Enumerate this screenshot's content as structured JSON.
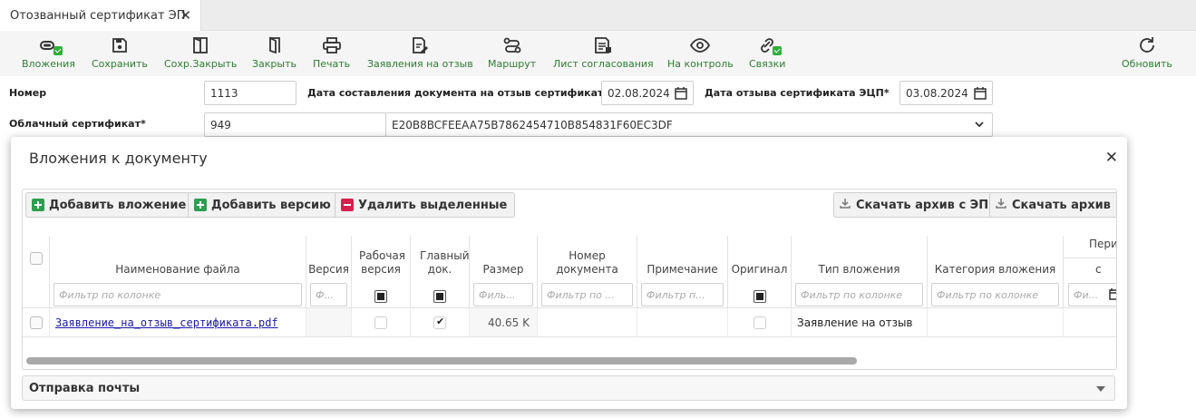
{
  "tab": {
    "title": "Отозванный сертификат ЭП",
    "close": "✕"
  },
  "toolbar": {
    "items": [
      {
        "label": "Вложения",
        "icon": "paperclip-icon"
      },
      {
        "label": "Сохранить",
        "icon": "save-icon"
      },
      {
        "label": "Сохр.Закрыть",
        "icon": "save-close-icon"
      },
      {
        "label": "Закрыть",
        "icon": "close-door-icon"
      },
      {
        "label": "Печать",
        "icon": "printer-icon"
      },
      {
        "label": "Заявления на отзыв",
        "icon": "document-edit-icon"
      },
      {
        "label": "Маршрут",
        "icon": "route-icon"
      },
      {
        "label": "Лист согласования",
        "icon": "approval-list-icon"
      },
      {
        "label": "На контроль",
        "icon": "eye-icon"
      },
      {
        "label": "Связки",
        "icon": "link-icon"
      }
    ],
    "refresh": {
      "label": "Обновить",
      "icon": "refresh-icon"
    },
    "accent_color": "#2e7d32"
  },
  "form": {
    "number": {
      "label": "Номер",
      "value": "1113"
    },
    "compose_date": {
      "label": "Дата составления документа на отзыв сертификата",
      "value": "02.08.2024"
    },
    "revoke_date": {
      "label": "Дата отзыва сертификата ЭЦП*",
      "value": "03.08.2024"
    },
    "cloud_cert": {
      "label": "Облачный сертификат*",
      "id": "949",
      "value": "E20B8BCFEEAA75B7862454710B854831F60EC3DF"
    }
  },
  "modal": {
    "title": "Вложения к документу",
    "close": "✕",
    "buttons": {
      "add_attachment": "Добавить вложение",
      "add_version": "Добавить версию",
      "delete_selected": "Удалить выделенные",
      "download_archive_ep": "Скачать архив с ЭП",
      "download_archive": "Скачать архив"
    },
    "columns": {
      "filename": "Наименование файла",
      "version": "Версия",
      "working_version": "Рабочая версия",
      "main_doc": "Главный док.",
      "size": "Размер",
      "doc_number": "Номер документа",
      "note": "Примечание",
      "original": "Оригинал",
      "attachment_type": "Тип вложения",
      "attachment_category": "Категория вложения",
      "period": "Пери",
      "period_from": "с"
    },
    "filters": {
      "filename": "Фильтр по колонке",
      "version": "Ф...",
      "size": "Филь...",
      "doc_number": "Фильтр по ...",
      "note": "Фильтр п...",
      "attachment_type": "Фильтр по колонке",
      "attachment_category": "Фильтр по колонке",
      "period_from": "Фи..."
    },
    "rows": [
      {
        "filename": "Заявление_на_отзыв_сертификата.pdf",
        "version": "",
        "working_version": false,
        "main_doc": true,
        "size": "40.65 K",
        "doc_number": "",
        "note": "",
        "original": false,
        "attachment_type": "Заявление на отзыв",
        "attachment_category": ""
      }
    ],
    "mail_section": "Отправка почты"
  }
}
